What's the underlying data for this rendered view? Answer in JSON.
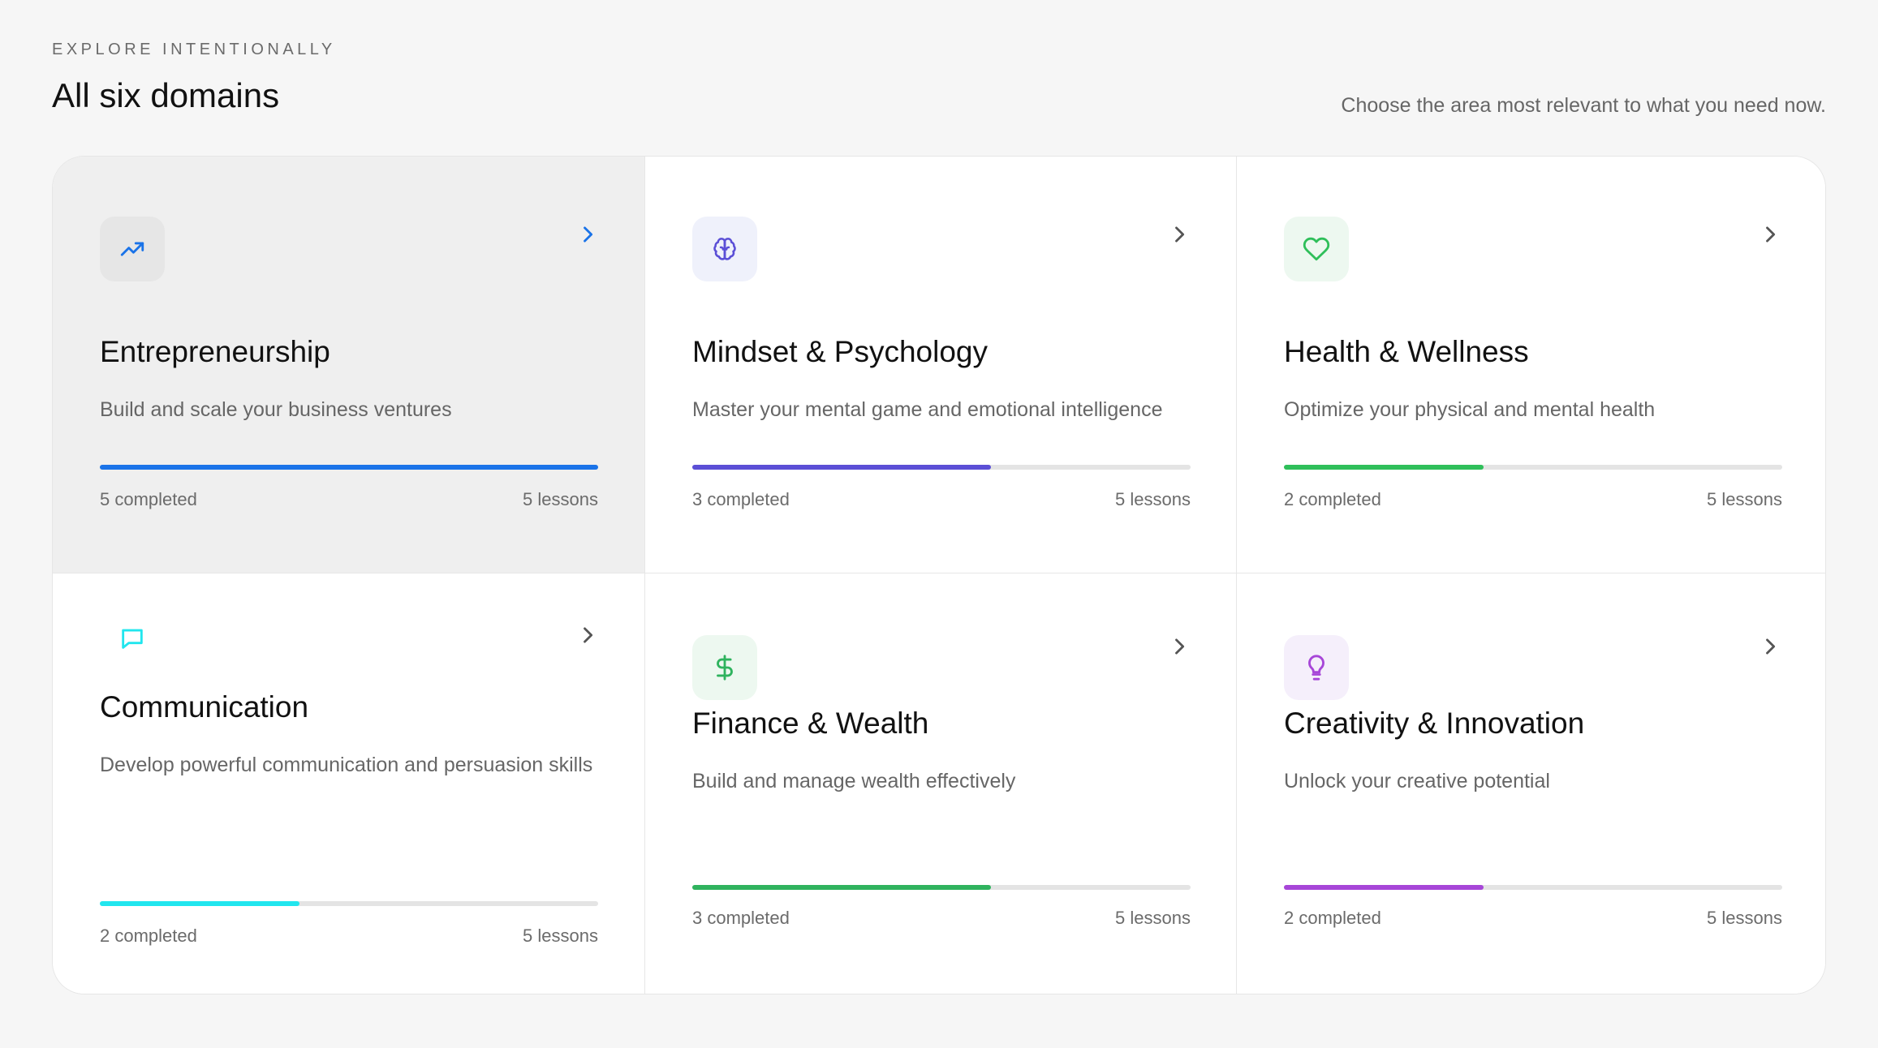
{
  "header": {
    "eyebrow": "EXPLORE INTENTIONALLY",
    "title": "All six domains",
    "subtitle": "Choose the area most relevant to what you need now."
  },
  "domains": [
    {
      "title": "Entrepreneurship",
      "description": "Build and scale your business ventures",
      "completed_label": "5 completed",
      "lessons_label": "5 lessons",
      "progress": 1.0,
      "icon": "trending-up-icon",
      "accent": "#1a73e8",
      "icon_bg": "#e6e6e6",
      "active": true
    },
    {
      "title": "Mindset & Psychology",
      "description": "Master your mental game and emotional intelligence",
      "completed_label": "3 completed",
      "lessons_label": "5 lessons",
      "progress": 0.6,
      "icon": "brain-icon",
      "accent": "#5b4fd6",
      "icon_bg": "#eff1fb",
      "active": false
    },
    {
      "title": "Health & Wellness",
      "description": "Optimize your physical and mental health",
      "completed_label": "2 completed",
      "lessons_label": "5 lessons",
      "progress": 0.4,
      "icon": "heart-icon",
      "accent": "#2fbf5a",
      "icon_bg": "#edf8f0",
      "active": false
    },
    {
      "title": "Communication",
      "description": "Develop powerful communication and persuasion skills",
      "completed_label": "2 completed",
      "lessons_label": "5 lessons",
      "progress": 0.4,
      "icon": "message-icon",
      "accent": "#21e6ee",
      "icon_bg": "#ffffff",
      "active": false
    },
    {
      "title": "Finance & Wealth",
      "description": "Build and manage wealth effectively",
      "completed_label": "3 completed",
      "lessons_label": "5 lessons",
      "progress": 0.6,
      "icon": "dollar-icon",
      "accent": "#2fb35e",
      "icon_bg": "#edf8f0",
      "active": false
    },
    {
      "title": "Creativity & Innovation",
      "description": "Unlock your creative potential",
      "completed_label": "2 completed",
      "lessons_label": "5 lessons",
      "progress": 0.4,
      "icon": "lightbulb-icon",
      "accent": "#a746d8",
      "icon_bg": "#f5effb",
      "active": false
    }
  ]
}
